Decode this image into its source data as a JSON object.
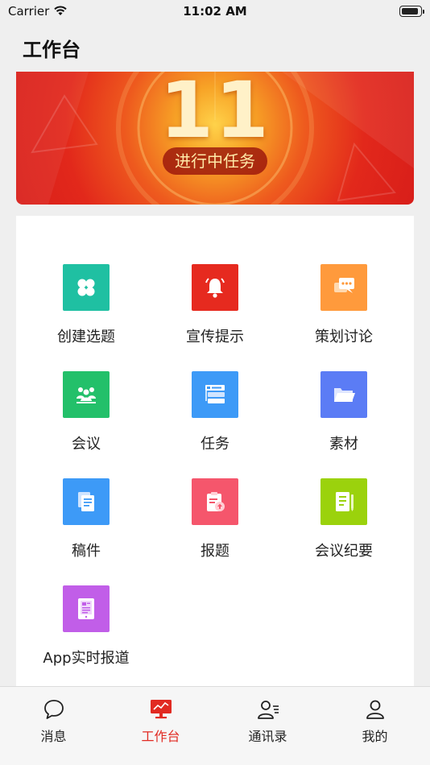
{
  "status": {
    "carrier": "Carrier",
    "time": "11:02 AM"
  },
  "header": {
    "title": "工作台"
  },
  "banner": {
    "count": "11",
    "label": "进行中任务"
  },
  "tiles": [
    {
      "label": "创建选题",
      "icon": "clover-icon",
      "color": "#1fc0a2"
    },
    {
      "label": "宣传提示",
      "icon": "bell-icon",
      "color": "#e62a1f"
    },
    {
      "label": "策划讨论",
      "icon": "chat-icon",
      "color": "#ff9a3c"
    },
    {
      "label": "会议",
      "icon": "meeting-icon",
      "color": "#23c06a"
    },
    {
      "label": "任务",
      "icon": "task-list-icon",
      "color": "#3d9af7"
    },
    {
      "label": "素材",
      "icon": "folder-icon",
      "color": "#5b7cf5"
    },
    {
      "label": "稿件",
      "icon": "document-icon",
      "color": "#3d9af7"
    },
    {
      "label": "报题",
      "icon": "clipboard-upload-icon",
      "color": "#f5566c"
    },
    {
      "label": "会议纪要",
      "icon": "notes-icon",
      "color": "#9bd20c"
    },
    {
      "label": "App实时报道",
      "icon": "tablet-news-icon",
      "color": "#c15ee8"
    }
  ],
  "tabbar": {
    "active_color": "#e12a22",
    "items": [
      {
        "label": "消息",
        "icon": "message-icon"
      },
      {
        "label": "工作台",
        "icon": "workbench-icon"
      },
      {
        "label": "通讯录",
        "icon": "contacts-icon"
      },
      {
        "label": "我的",
        "icon": "profile-icon"
      }
    ]
  }
}
